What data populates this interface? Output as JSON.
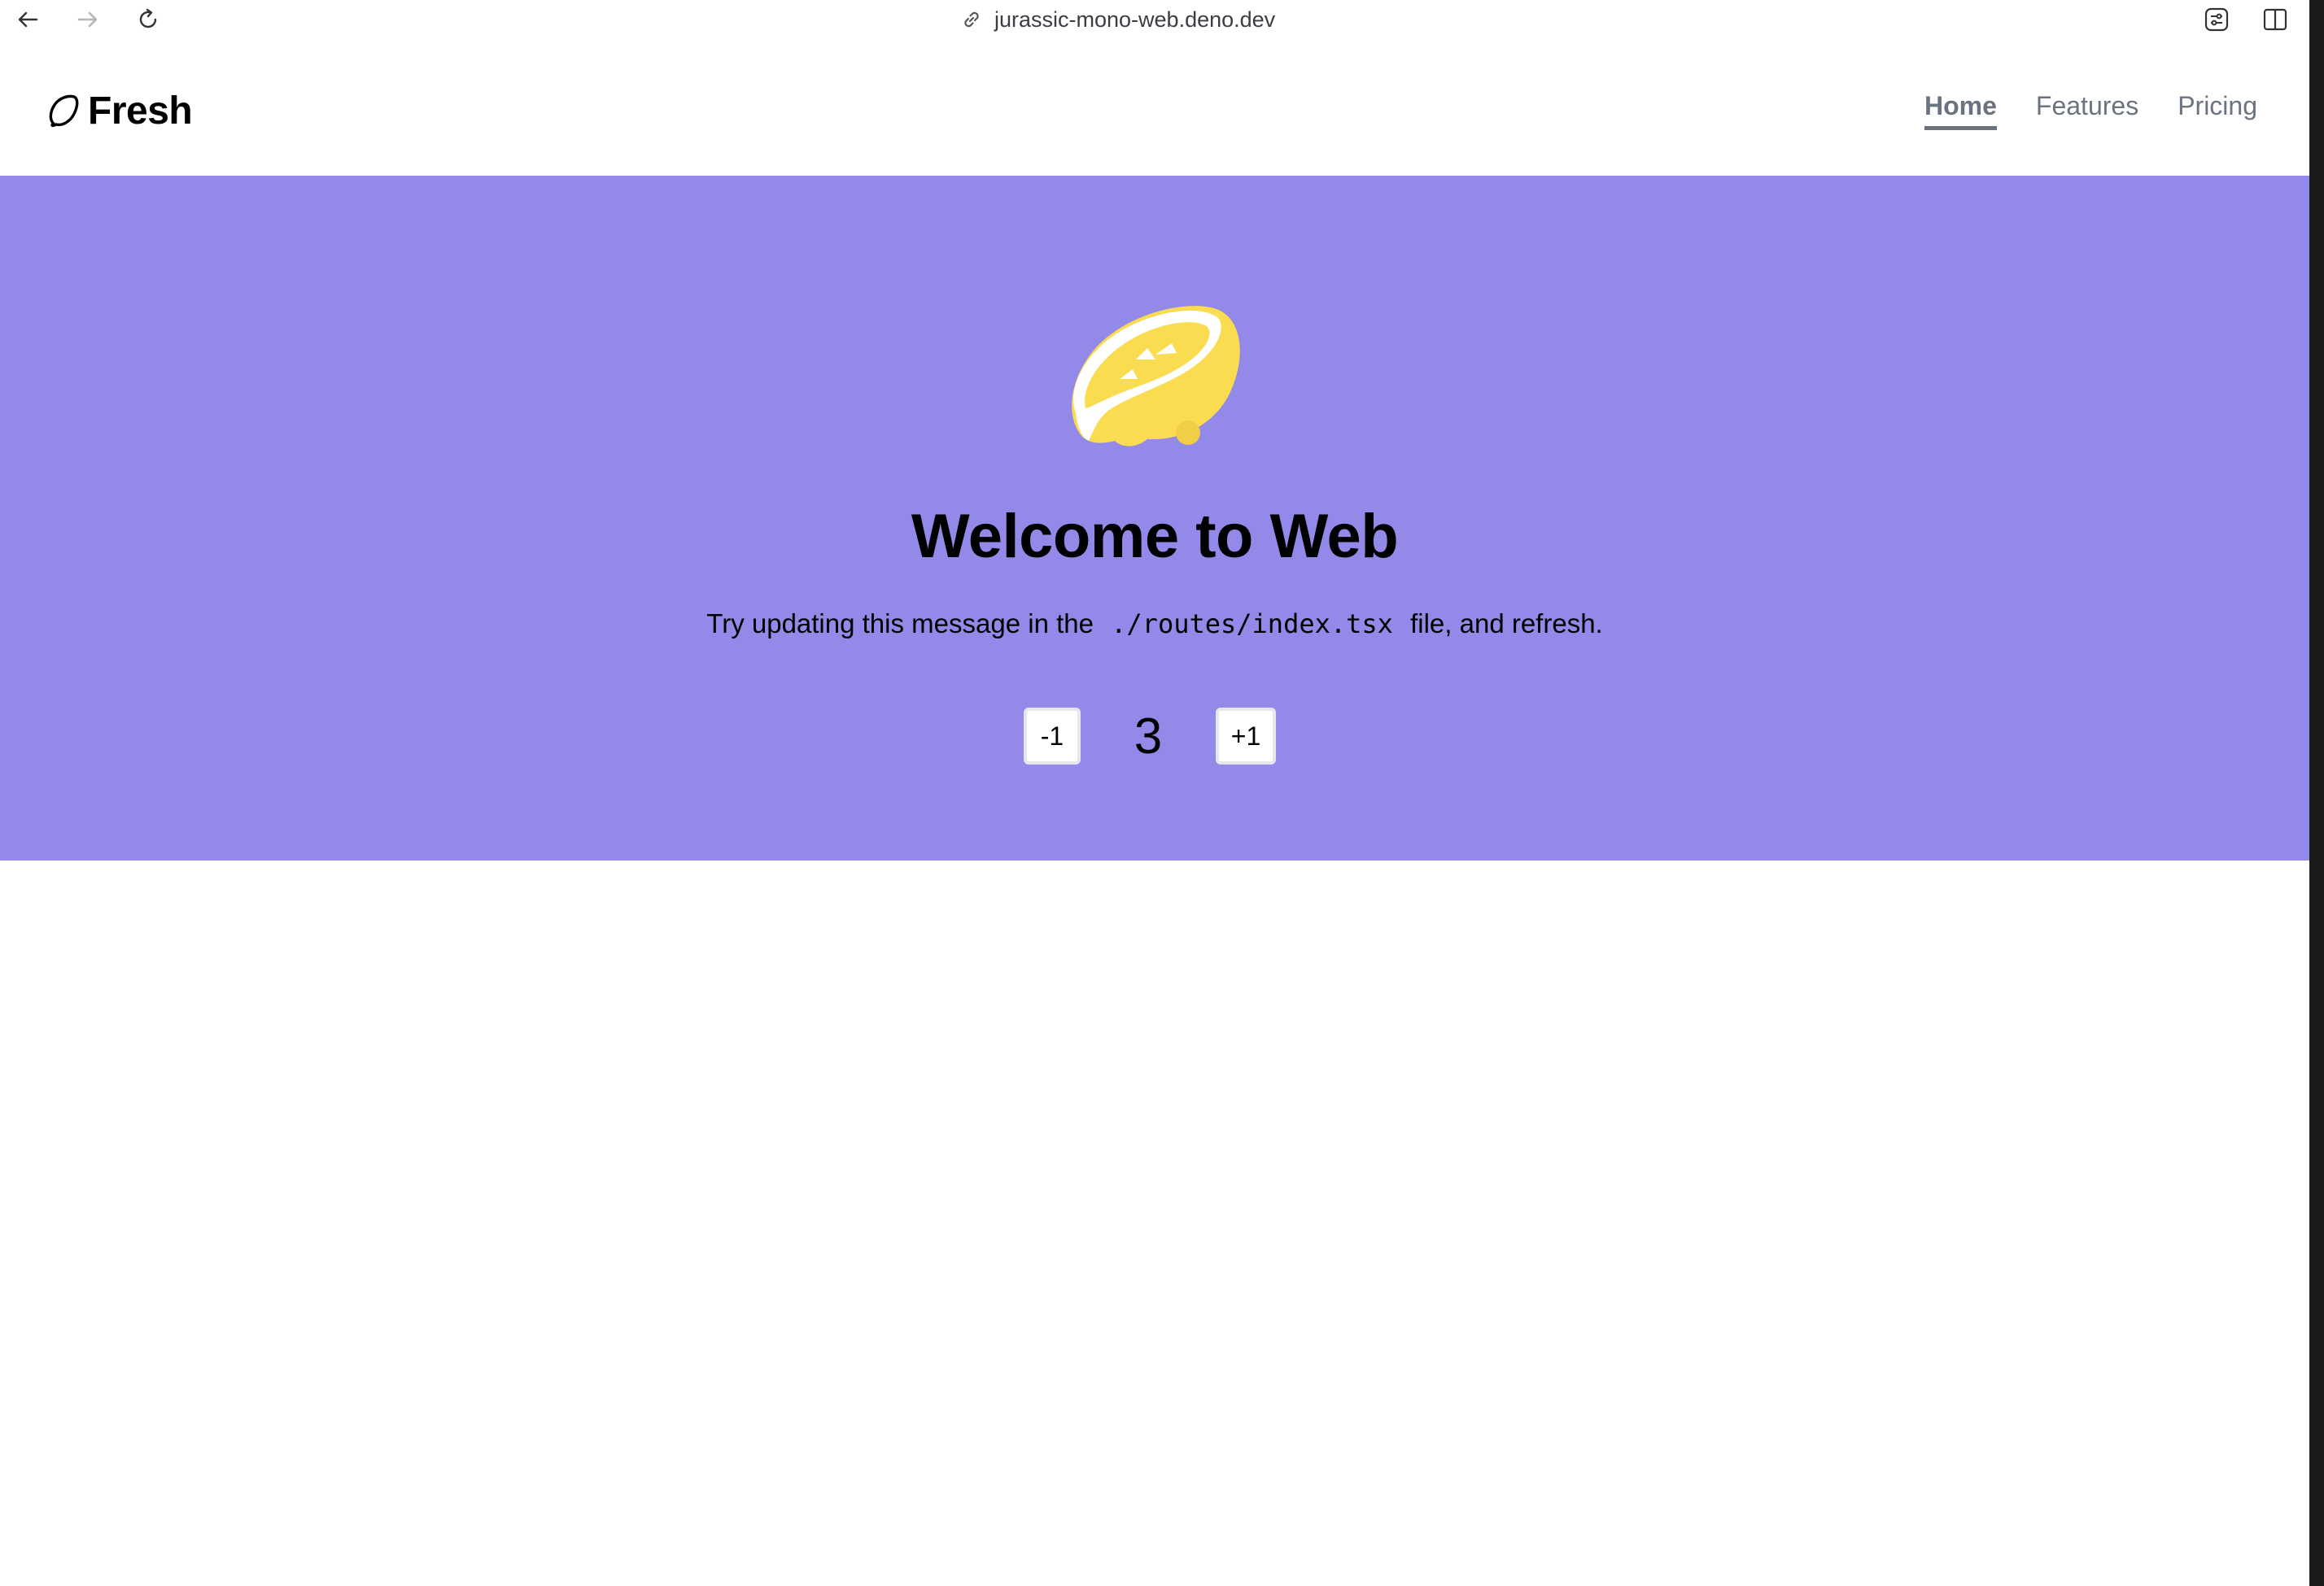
{
  "browser": {
    "url": "jurassic-mono-web.deno.dev",
    "icons": [
      "back-icon",
      "forward-icon",
      "reload-icon",
      "link-icon",
      "extensions-icon",
      "sidebar-icon"
    ]
  },
  "header": {
    "brand": "Fresh",
    "brand_icon": "lemon-outline-icon",
    "nav": [
      {
        "label": "Home",
        "active": true
      },
      {
        "label": "Features",
        "active": false
      },
      {
        "label": "Pricing",
        "active": false
      }
    ]
  },
  "hero": {
    "background": "#9289e8",
    "logo_icon": "fresh-lemon-logo",
    "title": "Welcome to Web",
    "subtitle_before": "Try updating this message in the",
    "subtitle_code": "./routes/index.tsx",
    "subtitle_after": "file, and refresh.",
    "counter": {
      "decrement_label": "-1",
      "value": "3",
      "increment_label": "+1"
    }
  },
  "colors": {
    "hero_bg": "#9289e8",
    "lemon": "#f9dc4f",
    "nav_text": "#6b7280"
  }
}
